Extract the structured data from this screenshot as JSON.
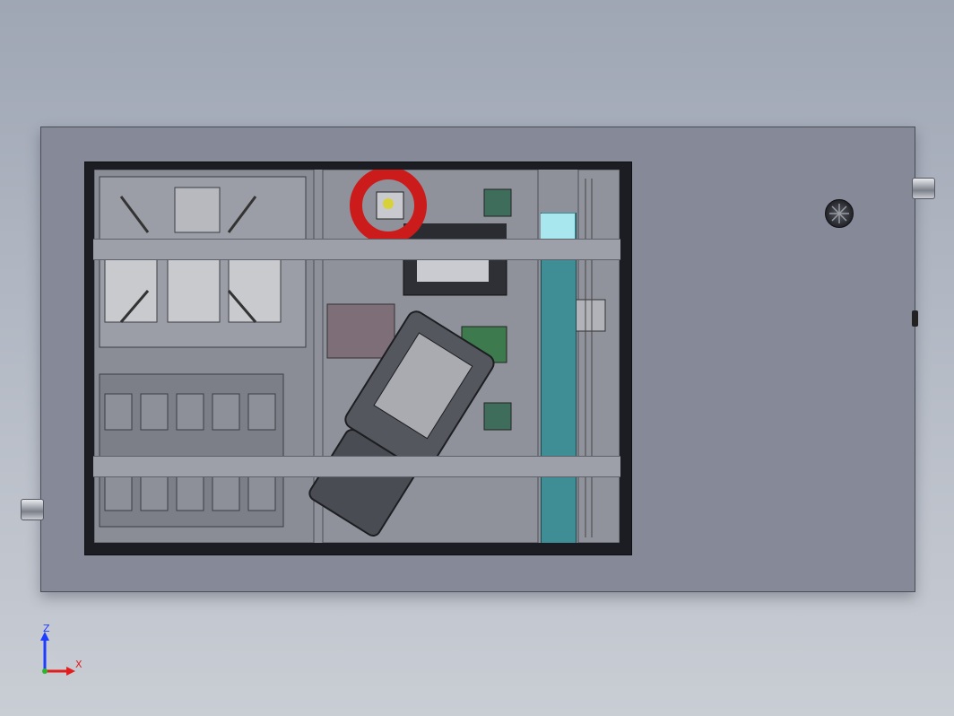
{
  "triad": {
    "z_label": "Z",
    "x_label": "X",
    "z_color": "#1e3cff",
    "x_color": "#e21d1d"
  },
  "colors": {
    "cabinet": "#858998",
    "window_frame": "#1c1d22",
    "conveyor": "#3f8e95",
    "conveyor_highlight": "#a9e7ee",
    "highlight_ring": "#cc1b1b"
  }
}
